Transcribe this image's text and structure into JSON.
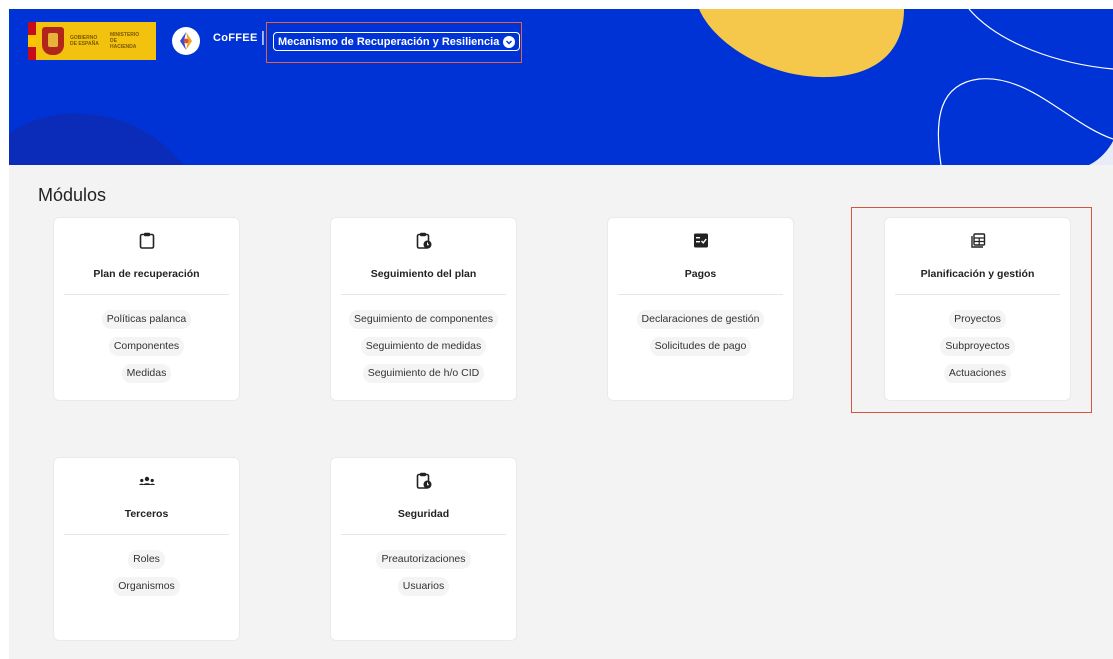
{
  "header": {
    "gov_logo_lines": [
      "GOBIERNO DE ESPAÑA",
      "MINISTERIO DE HACIENDA"
    ],
    "app_name": "CoFFEE",
    "separator": "|",
    "plan_selector": {
      "value": "Mecanismo de Recuperación y Resiliencia",
      "icon": "chevron-down-icon"
    },
    "colors": {
      "banner": "#0033d6",
      "accent_yellow": "#f5c84b",
      "highlight": "#d2553f"
    }
  },
  "main": {
    "title": "Módulos",
    "cards": [
      {
        "title": "Plan de recuperación",
        "icon": "clipboard-icon",
        "links": [
          "Políticas palanca",
          "Componentes",
          "Medidas"
        ]
      },
      {
        "title": "Seguimiento del plan",
        "icon": "clipboard-clock-icon",
        "links": [
          "Seguimiento de componentes",
          "Seguimiento de medidas",
          "Seguimiento de h/o CID"
        ]
      },
      {
        "title": "Pagos",
        "icon": "file-check-icon",
        "links": [
          "Declaraciones de gestión",
          "Solicitudes de pago"
        ]
      },
      {
        "title": "Planificación y gestión",
        "icon": "table-stack-icon",
        "links": [
          "Proyectos",
          "Subproyectos",
          "Actuaciones"
        ]
      },
      {
        "title": "Terceros",
        "icon": "users-icon",
        "links": [
          "Roles",
          "Organismos"
        ]
      },
      {
        "title": "Seguridad",
        "icon": "clipboard-clock-icon",
        "links": [
          "Preautorizaciones",
          "Usuarios"
        ]
      }
    ]
  }
}
